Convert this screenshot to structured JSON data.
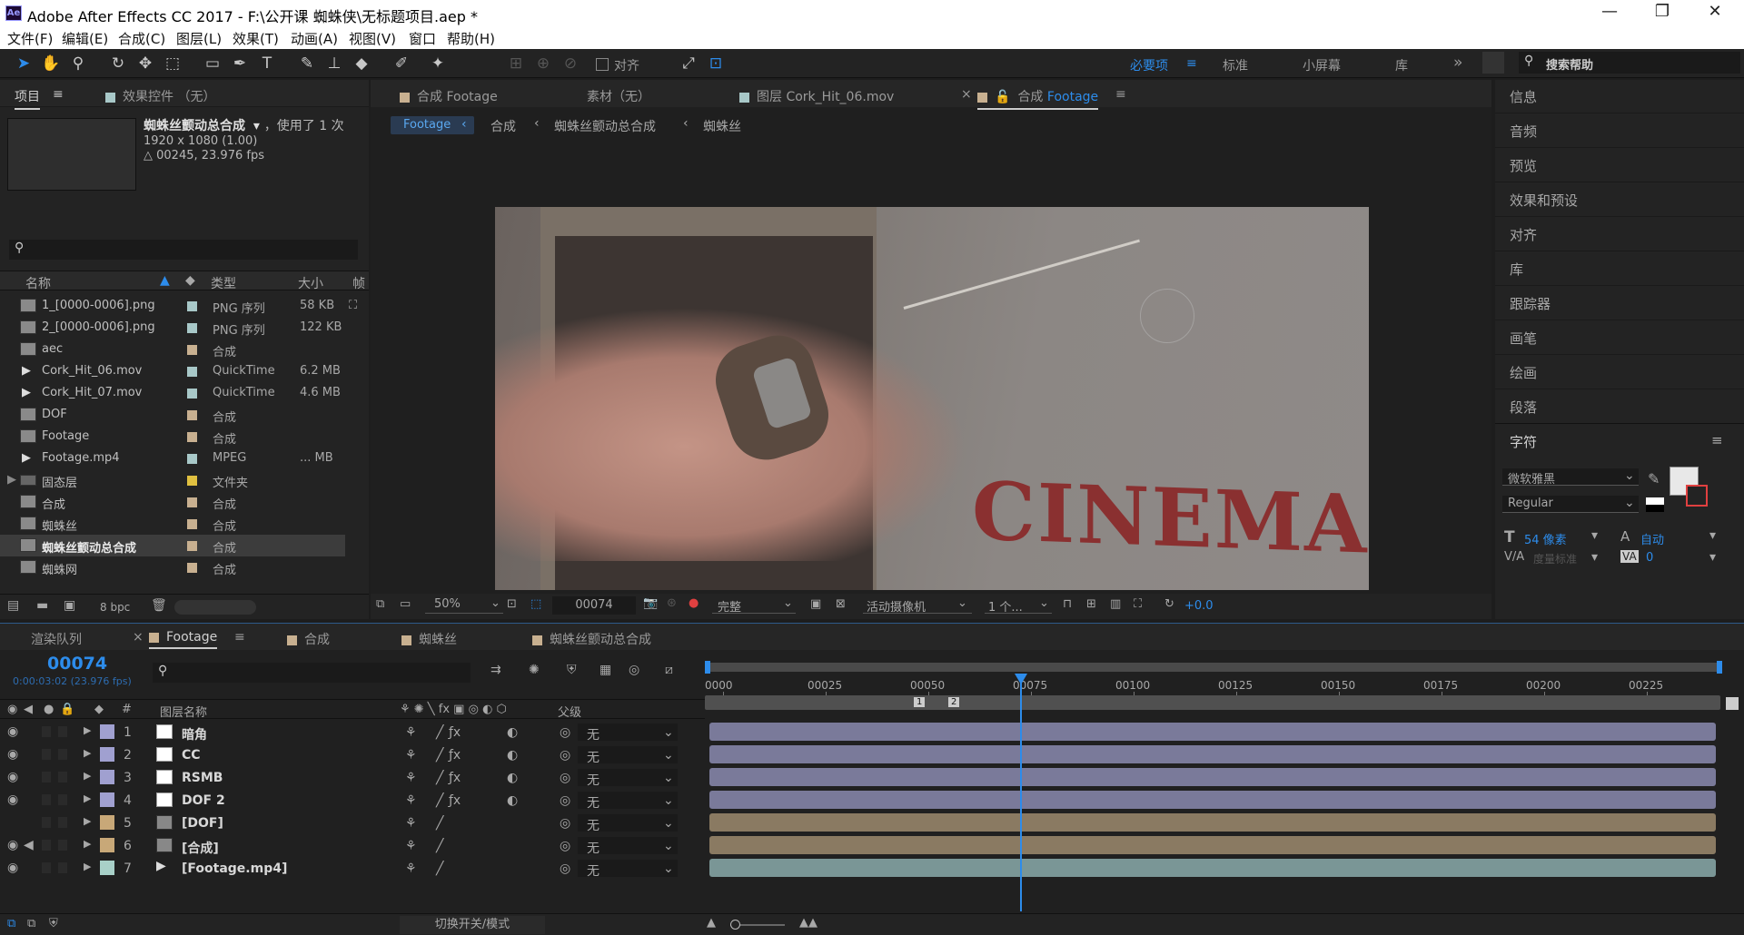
{
  "window": {
    "title": "Adobe After Effects CC 2017 - F:\\公开课 蜘蛛侠\\无标题项目.aep *",
    "logo": "Ae",
    "minimize": "—",
    "maximize": "❐",
    "close": "✕"
  },
  "menu": [
    "文件(F)",
    "编辑(E)",
    "合成(C)",
    "图层(L)",
    "效果(T)",
    "动画(A)",
    "视图(V)",
    "窗口",
    "帮助(H)"
  ],
  "toolbar": {
    "align_label": "对齐",
    "workspaces": [
      "必要项",
      "标准",
      "小屏幕",
      "库"
    ],
    "search_placeholder": "搜索帮助",
    "more": "»"
  },
  "project_panel": {
    "tabs": [
      "项目",
      "效果控件 （无）"
    ],
    "comp_name": "蜘蛛丝颤动总合成",
    "used": "，使用了 1 次",
    "res": "1920 x 1080 (1.00)",
    "dur": "△ 00245, 23.976 fps",
    "search_placeholder": "",
    "columns": [
      "名称",
      "类型",
      "大小",
      "帧"
    ],
    "items": [
      {
        "name": "1_[0000-0006].png",
        "type": "PNG 序列",
        "size": "58 KB",
        "color": "#a8c8c8"
      },
      {
        "name": "2_[0000-0006].png",
        "type": "PNG 序列",
        "size": "122 KB",
        "color": "#a8c8c8"
      },
      {
        "name": "aec",
        "type": "合成",
        "size": "",
        "color": "#c8b090"
      },
      {
        "name": "Cork_Hit_06.mov",
        "type": "QuickTime",
        "size": "6.2 MB",
        "color": "#a8c8c8"
      },
      {
        "name": "Cork_Hit_07.mov",
        "type": "QuickTime",
        "size": "4.6 MB",
        "color": "#a8c8c8"
      },
      {
        "name": "DOF",
        "type": "合成",
        "size": "",
        "color": "#c8b090"
      },
      {
        "name": "Footage",
        "type": "合成",
        "size": "",
        "color": "#c8b090"
      },
      {
        "name": "Footage.mp4",
        "type": "MPEG",
        "size": "... MB",
        "color": "#a8c8c8"
      },
      {
        "name": "固态层",
        "type": "文件夹",
        "size": "",
        "color": "#e0c040"
      },
      {
        "name": "合成",
        "type": "合成",
        "size": "",
        "color": "#c8b090"
      },
      {
        "name": "蜘蛛丝",
        "type": "合成",
        "size": "",
        "color": "#c8b090"
      },
      {
        "name": "蜘蛛丝颤动总合成",
        "type": "合成",
        "size": "",
        "color": "#c8b090"
      },
      {
        "name": "蜘蛛网",
        "type": "合成",
        "size": "",
        "color": "#c8b090"
      }
    ],
    "bpc": "8 bpc"
  },
  "viewer": {
    "tabs": [
      "合成 Footage",
      "素材（无）",
      "图层 Cork_Hit_06.mov",
      "合成 Footage"
    ],
    "active_tab_prefix": "合成",
    "active_tab_name": "Footage",
    "breadcrumbs": [
      "Footage",
      "合成",
      "蜘蛛丝颤动总合成",
      "蜘蛛丝"
    ],
    "zoom": "50%",
    "timecode": "00074",
    "quality": "完整",
    "camera": "活动摄像机",
    "views": "1 个...",
    "exposure": "+0.0",
    "scene_text": "CINEMA"
  },
  "right_panel": {
    "items": [
      "信息",
      "音频",
      "预览",
      "效果和预设",
      "对齐",
      "库",
      "跟踪器",
      "画笔",
      "绘画",
      "段落",
      "字符"
    ],
    "font": "微软雅黑",
    "style": "Regular",
    "size": "54 像素",
    "leading": "自动",
    "tracking_label": "度量标准",
    "tracking": "0"
  },
  "timeline": {
    "tabs": [
      "渲染队列",
      "Footage",
      "合成",
      "蜘蛛丝",
      "蜘蛛丝颤动总合成"
    ],
    "timecode": "00074",
    "timecode_sub": "0:00:03:02 (23.976 fps)",
    "columns": {
      "num": "#",
      "name": "图层名称",
      "parent": "父级"
    },
    "ruler": [
      "0000",
      "00025",
      "00050",
      "00075",
      "00100",
      "00125",
      "00150",
      "00175",
      "00200",
      "00225"
    ],
    "layers": [
      {
        "num": "1",
        "name": "暗角",
        "color": "#a0a0d0",
        "parent": "无",
        "bar": "#7a7a9a"
      },
      {
        "num": "2",
        "name": "CC",
        "color": "#a0a0d0",
        "parent": "无",
        "bar": "#7a7a9a"
      },
      {
        "num": "3",
        "name": "RSMB",
        "color": "#a0a0d0",
        "parent": "无",
        "bar": "#7a7a9a"
      },
      {
        "num": "4",
        "name": "DOF 2",
        "color": "#a0a0d0",
        "parent": "无",
        "bar": "#7a7a9a"
      },
      {
        "num": "5",
        "name": "[DOF]",
        "color": "#c8a878",
        "parent": "无",
        "bar": "#8a7a62"
      },
      {
        "num": "6",
        "name": "[合成]",
        "color": "#c8a878",
        "parent": "无",
        "bar": "#8a7a62"
      },
      {
        "num": "7",
        "name": "[Footage.mp4]",
        "color": "#a8d0c8",
        "parent": "无",
        "bar": "#7a9696"
      }
    ],
    "bottom_label": "切换开关/模式",
    "markers": [
      "1",
      "2"
    ]
  },
  "colors": {
    "accent": "#2d8ceb",
    "playhead": "#2d8ceb"
  }
}
